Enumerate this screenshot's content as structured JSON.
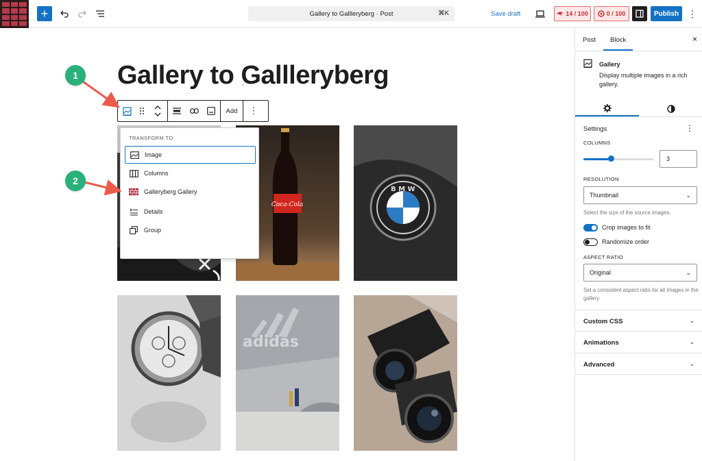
{
  "topbar": {
    "add_icon": "+",
    "command_title": "Gallery to Gallleryberg · Post",
    "command_shortcut": "⌘K",
    "save_draft": "Save draft",
    "score1": "14 / 100",
    "score2": "0 / 100",
    "publish": "Publish",
    "more": "⋮"
  },
  "editor": {
    "post_title": "Gallery to Gallleryberg",
    "toolbar_add": "Add",
    "toolbar_more": "⋮"
  },
  "transform_menu": {
    "header": "TRANSFORM TO",
    "items": [
      {
        "label": "Image",
        "icon": "image-icon"
      },
      {
        "label": "Columns",
        "icon": "columns-icon"
      },
      {
        "label": "Galleryberg Gallery",
        "icon": "galleryberg-icon"
      },
      {
        "label": "Details",
        "icon": "details-icon"
      },
      {
        "label": "Group",
        "icon": "group-icon"
      }
    ]
  },
  "callouts": [
    "1",
    "2"
  ],
  "gallery": {
    "images": [
      "dark-still-life",
      "coca-cola-bottle",
      "bmw-emblem",
      "wristwatch",
      "adidas-building",
      "cameras"
    ],
    "adidas_text": "adidas",
    "coke_text": "Coca-Cola"
  },
  "sidebar": {
    "tabs": [
      "Post",
      "Block"
    ],
    "active_tab": "Block",
    "close": "×",
    "block_title": "Gallery",
    "block_desc": "Display multiple images in a rich gallery.",
    "settings_title": "Settings",
    "columns_label": "COLUMNS",
    "columns_value": "3",
    "columns_slider_fraction": 0.4,
    "resolution_label": "RESOLUTION",
    "resolution_value": "Thumbnail",
    "resolution_help": "Select the size of the source images.",
    "crop_label": "Crop images to fit",
    "crop_on": true,
    "randomize_label": "Randomize order",
    "randomize_on": false,
    "aspect_label": "ASPECT RATIO",
    "aspect_value": "Original",
    "aspect_help": "Set a consistent aspect ratio for all images in the gallery.",
    "panels": [
      "Custom CSS",
      "Animations",
      "Advanced"
    ]
  },
  "colors": {
    "accent": "#1472c4",
    "callout": "#2ab07a",
    "arrow": "#ec5a4a",
    "brand": "#b33a4a"
  }
}
